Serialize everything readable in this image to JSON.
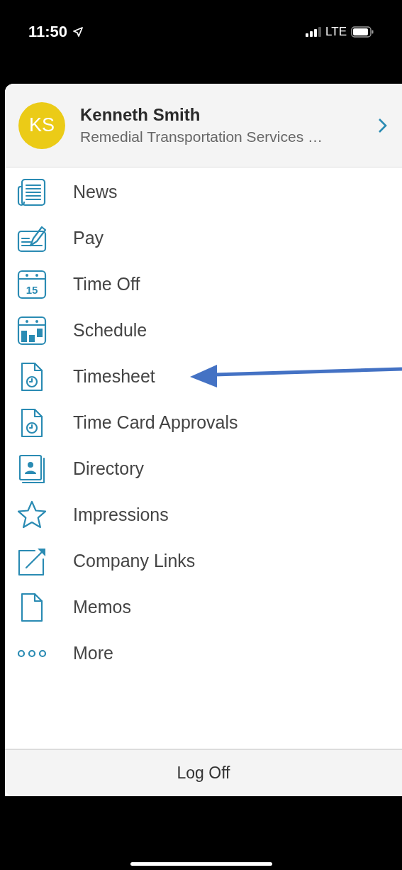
{
  "status_bar": {
    "time": "11:50",
    "network": "LTE"
  },
  "profile": {
    "initials": "KS",
    "name": "Kenneth Smith",
    "company": "Remedial Transportation Services …"
  },
  "menu": [
    {
      "label": "News"
    },
    {
      "label": "Pay"
    },
    {
      "label": "Time Off",
      "icon_label": "15"
    },
    {
      "label": "Schedule"
    },
    {
      "label": "Timesheet"
    },
    {
      "label": "Time Card Approvals"
    },
    {
      "label": "Directory"
    },
    {
      "label": "Impressions"
    },
    {
      "label": "Company Links"
    },
    {
      "label": "Memos"
    },
    {
      "label": "More"
    }
  ],
  "footer": {
    "button": "Log Off"
  }
}
